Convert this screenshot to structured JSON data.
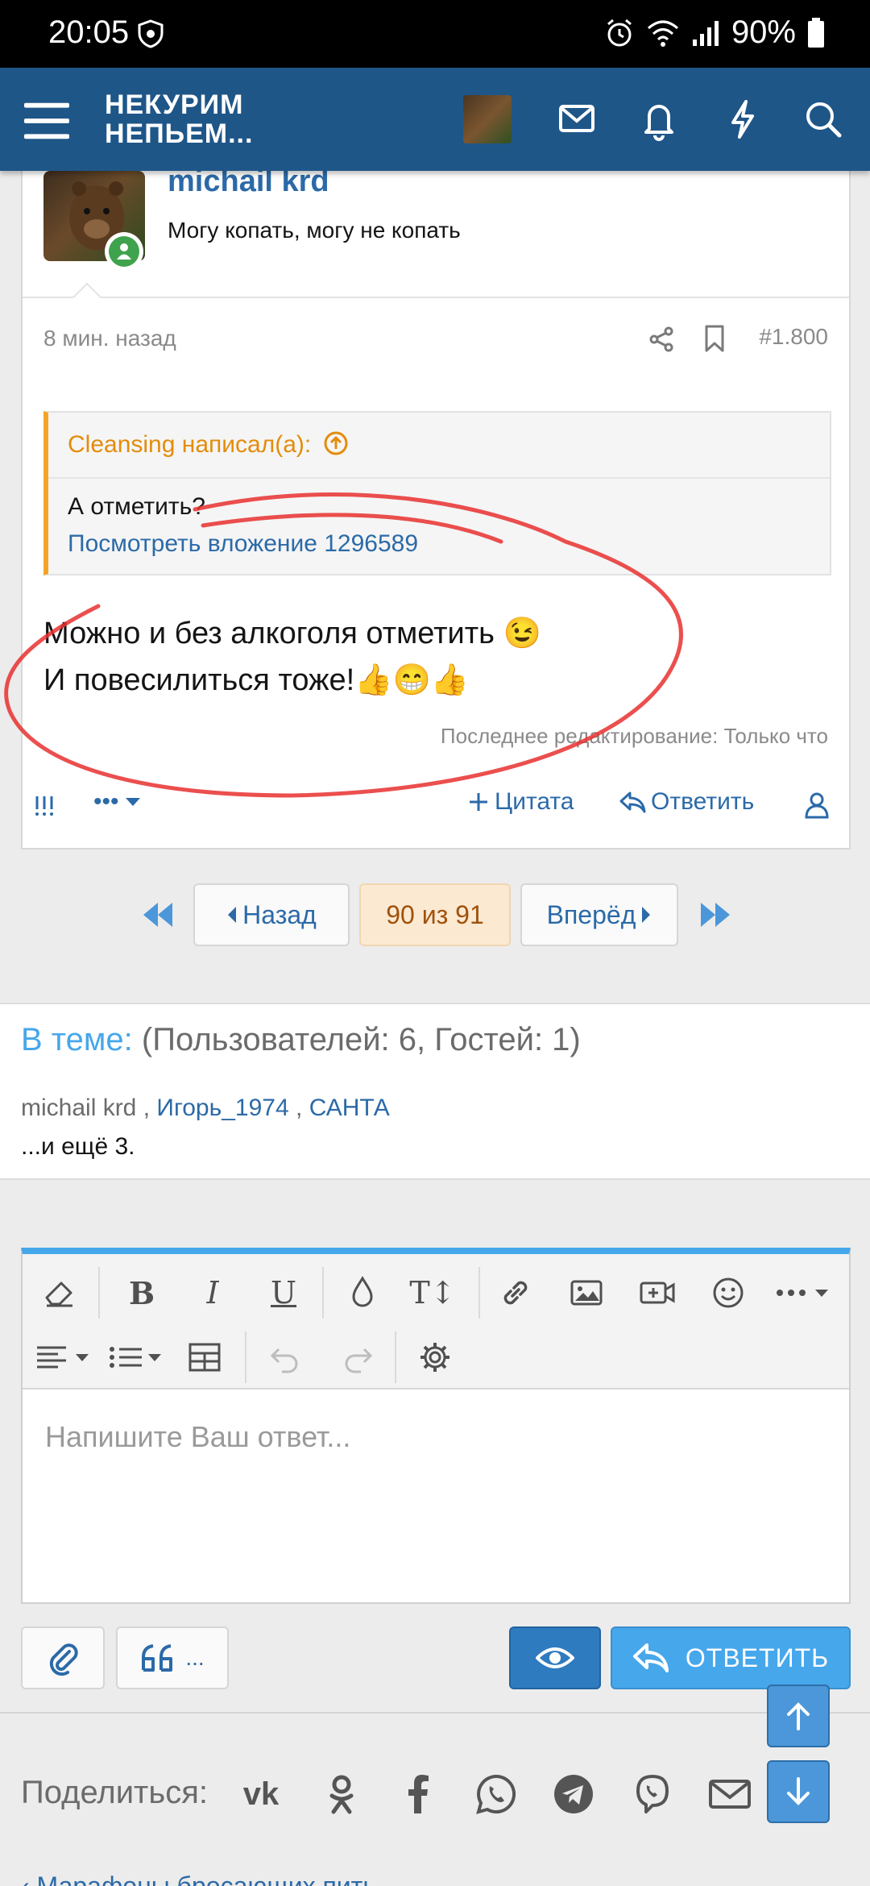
{
  "status_bar": {
    "time": "20:05",
    "battery": "90%"
  },
  "header": {
    "brand_line1": "НЕКУРИМ",
    "brand_line2": "НЕПЬЕМ..."
  },
  "post": {
    "author": "michail krd",
    "user_title": "Могу копать, могу не копать",
    "time": "8 мин. назад",
    "post_number": "#1.800",
    "quote": {
      "header": "Cleansing написал(а):",
      "text": "А отметить?",
      "link": "Посмотреть вложение 1296589"
    },
    "body_line1": "Можно и без алкоголя отметить 😉",
    "body_line2": "И повесилиться тоже!👍😁👍",
    "edited": "Последнее редактирование: Только что",
    "actions": {
      "more": "•••",
      "quote": "Цитата",
      "reply": "Ответить"
    }
  },
  "pagination": {
    "prev": "Назад",
    "current": "90 из 91",
    "next": "Вперёд"
  },
  "online": {
    "title_key": "В теме:",
    "title_value": "(Пользователей: 6, Гостей: 1)",
    "users": [
      "michail krd",
      "Игорь_1974",
      "САНТА"
    ],
    "more": "...и ещё 3."
  },
  "editor": {
    "placeholder": "Напишите Ваш ответ..."
  },
  "buttons": {
    "insert_quotes": "...",
    "reply": "ОТВЕТИТЬ"
  },
  "share": {
    "label": "Поделиться:"
  },
  "breadcrumb": "Марафоны бросающих пить"
}
